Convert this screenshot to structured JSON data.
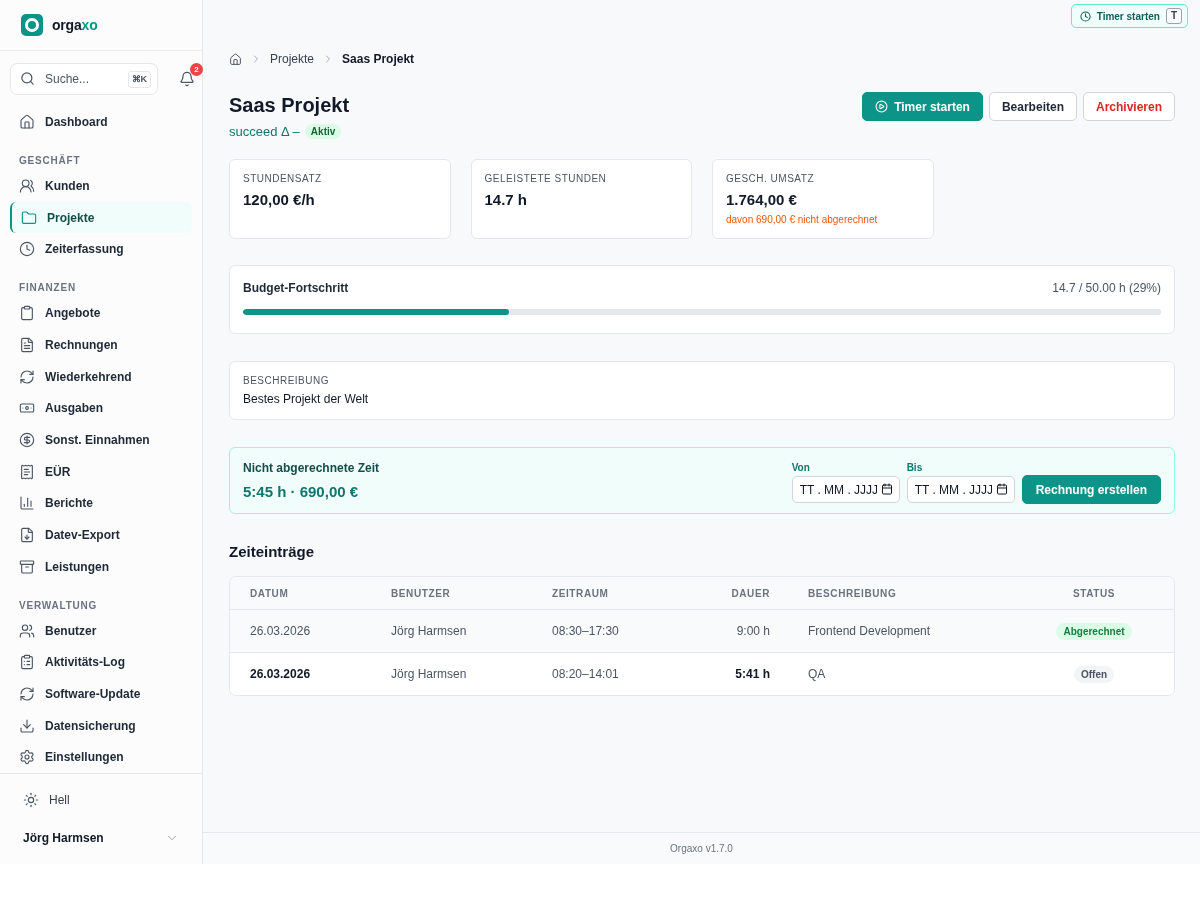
{
  "sidebar": {
    "logo": {
      "text_start": "orga",
      "text_end": "xo"
    },
    "search": {
      "placeholder": "Suche...",
      "shortcut": "⌘K"
    },
    "notifications": {
      "count": "2"
    },
    "nav_groups": [
      {
        "items": [
          {
            "label": "Dashboard",
            "selected": false
          }
        ]
      },
      {
        "heading": "GESCHÄFT",
        "items": [
          {
            "label": "Kunden",
            "selected": false
          },
          {
            "label": "Projekte",
            "selected": true
          },
          {
            "label": "Zeiterfassung",
            "selected": false
          }
        ]
      },
      {
        "heading": "FINANZEN",
        "items": [
          {
            "label": "Angebote",
            "selected": false
          },
          {
            "label": "Rechnungen",
            "selected": false
          },
          {
            "label": "Wiederkehrend",
            "selected": false
          },
          {
            "label": "Ausgaben",
            "selected": false
          },
          {
            "label": "Sonst. Einnahmen",
            "selected": false
          },
          {
            "label": "EÜR",
            "selected": false
          },
          {
            "label": "Berichte",
            "selected": false
          },
          {
            "label": "Datev-Export",
            "selected": false
          },
          {
            "label": "Leistungen",
            "selected": false
          }
        ]
      },
      {
        "heading": "VERWALTUNG",
        "items": [
          {
            "label": "Benutzer",
            "selected": false
          },
          {
            "label": "Aktivitäts-Log",
            "selected": false
          },
          {
            "label": "Software-Update",
            "selected": false
          },
          {
            "label": "Datensicherung",
            "selected": false
          },
          {
            "label": "Einstellungen",
            "selected": false
          }
        ]
      }
    ],
    "theme_toggle": {
      "label": "Hell"
    },
    "user": {
      "name": "Jörg Harmsen"
    }
  },
  "top_bar": {
    "timer_button": {
      "label": "Timer starten",
      "shortcut": "T"
    }
  },
  "breadcrumb": [
    "Projekte",
    "Saas Projekt"
  ],
  "header": {
    "title": "Saas Projekt",
    "subtitle": "succeed Δ –",
    "status_badge": "Aktiv",
    "actions": [
      {
        "label": "Timer starten",
        "kind": "primary"
      },
      {
        "label": "Bearbeiten",
        "kind": "secondary"
      },
      {
        "label": "Archivieren",
        "kind": "danger"
      }
    ]
  },
  "stats": [
    {
      "label": "STUNDENSATZ",
      "value": "120,00 €/h"
    },
    {
      "label": "GELEISTETE STUNDEN",
      "value": "14.7 h"
    },
    {
      "label": "GESCH. UMSATZ",
      "value": "1.764,00 €",
      "note": "davon 690,00 € nicht abgerechnet"
    }
  ],
  "budget": {
    "title": "Budget-Fortschritt",
    "reading": "14.7 / 50.00 h (29%)",
    "level": 0.29
  },
  "description": {
    "label": "BESCHREIBUNG",
    "text": "Bestes Projekt der Welt"
  },
  "unbilled": {
    "title": "Nicht abgerechnete Zeit",
    "summary": "5:45 h · 690,00 €",
    "from": {
      "label": "Von",
      "placeholder": "TT . MM . JJJJ"
    },
    "to": {
      "label": "Bis",
      "placeholder": "TT . MM . JJJJ"
    },
    "button": "Rechnung erstellen"
  },
  "time_entries": {
    "title": "Zeiteinträge",
    "columns": [
      "DATUM",
      "BENUTZER",
      "ZEITRAUM",
      "DAUER",
      "BESCHREIBUNG",
      "STATUS"
    ],
    "rows": [
      {
        "date": "26.03.2026",
        "user": "Jörg Harmsen",
        "period": "08:30–17:30",
        "duration": "9:00 h",
        "description": "Frontend Development",
        "status": {
          "label": "Abgerechnet",
          "kind": "billed"
        }
      },
      {
        "date": "26.03.2026",
        "user": "Jörg Harmsen",
        "period": "08:20–14:01",
        "duration": "5:41 h",
        "description": "QA",
        "status": {
          "label": "Offen",
          "kind": "open"
        }
      }
    ]
  },
  "footer": {
    "version": "Orgaxo v1.7.0"
  }
}
